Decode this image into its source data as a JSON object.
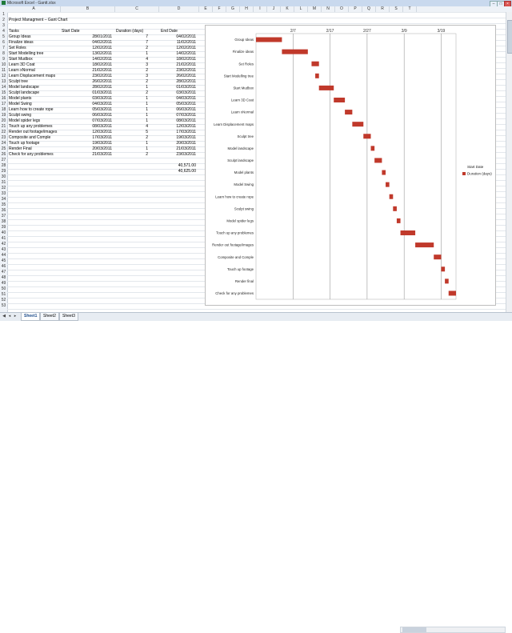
{
  "window": {
    "title": "Microsoft Excel - Gantt.xlsx"
  },
  "columns": [
    "A",
    "B",
    "C",
    "D",
    "E",
    "F",
    "G",
    "H",
    "I",
    "J",
    "K",
    "L",
    "M",
    "N",
    "O",
    "P",
    "Q",
    "R",
    "S",
    "T"
  ],
  "sheet": {
    "title": "Project Managment – Gant Chart",
    "headers": {
      "task": "Tasks",
      "start": "Start Date",
      "duration": "Duration (days)",
      "end": "End Date"
    },
    "rows": [
      {
        "task": "Group Ideas",
        "start": "28/01/2011",
        "duration": "7",
        "end": "04/02/2011"
      },
      {
        "task": "Finalize ideas",
        "start": "04/02/2011",
        "duration": "7",
        "end": "11/02/2011"
      },
      {
        "task": "Set Roles",
        "start": "12/02/2011",
        "duration": "2",
        "end": "12/02/2011"
      },
      {
        "task": "Start Modelling tree",
        "start": "13/02/2011",
        "duration": "1",
        "end": "14/02/2011"
      },
      {
        "task": "Start Mudbox",
        "start": "14/02/2011",
        "duration": "4",
        "end": "18/02/2011"
      },
      {
        "task": "Learn 3D Coat",
        "start": "18/02/2011",
        "duration": "3",
        "end": "21/02/2011"
      },
      {
        "task": "Learn xNormal",
        "start": "21/02/2011",
        "duration": "2",
        "end": "23/02/2011"
      },
      {
        "task": "Learn Displacement maps",
        "start": "23/02/2011",
        "duration": "3",
        "end": "26/02/2011"
      },
      {
        "task": "Sculpt tree",
        "start": "26/02/2011",
        "duration": "2",
        "end": "28/02/2011"
      },
      {
        "task": "Model landscape",
        "start": "28/02/2011",
        "duration": "1",
        "end": "01/03/2011"
      },
      {
        "task": "Sculpt landscape",
        "start": "01/03/2011",
        "duration": "2",
        "end": "03/03/2011"
      },
      {
        "task": "Model plants",
        "start": "03/03/2011",
        "duration": "1",
        "end": "04/03/2011"
      },
      {
        "task": "Model Swing",
        "start": "04/03/2011",
        "duration": "1",
        "end": "05/03/2011"
      },
      {
        "task": "Learn how to create rope",
        "start": "05/03/2011",
        "duration": "1",
        "end": "06/03/2011"
      },
      {
        "task": "Sculpt swing",
        "start": "06/03/2011",
        "duration": "1",
        "end": "07/03/2011"
      },
      {
        "task": "Model spider legs",
        "start": "07/03/2011",
        "duration": "1",
        "end": "08/03/2011"
      },
      {
        "task": "Touch up any problemes",
        "start": "08/03/2011",
        "duration": "4",
        "end": "12/03/2011"
      },
      {
        "task": "Render out footage/images",
        "start": "12/03/2011",
        "duration": "5",
        "end": "17/03/2011"
      },
      {
        "task": "Composite and Comple",
        "start": "17/03/2011",
        "duration": "2",
        "end": "19/03/2011"
      },
      {
        "task": "Touch up footage",
        "start": "19/03/2011",
        "duration": "1",
        "end": "20/03/2011"
      },
      {
        "task": "Render Final",
        "start": "20/03/2011",
        "duration": "1",
        "end": "21/03/2011"
      },
      {
        "task": "Check for any problemes",
        "start": "21/03/2011",
        "duration": "2",
        "end": "23/03/2011"
      }
    ],
    "extra_values": [
      "40,571.00",
      "40,625.00"
    ]
  },
  "chart_data": {
    "type": "bar",
    "orientation": "horizontal",
    "categories": [
      "Group Ideas",
      "Finalize ideas",
      "Set Roles",
      "Start Modelling tree",
      "Start Mudbox",
      "Learn 3D Coat",
      "Learn xNormal",
      "Learn Displacement maps",
      "Sculpt tree",
      "Model landscape",
      "Sculpt landscape",
      "Model plants",
      "Model Swing",
      "Learn how to create rope",
      "Sculpt swing",
      "Model spider legs",
      "Touch up any problemes",
      "Render out footage/images",
      "Composite and Comple",
      "Touch up footage",
      "Render final",
      "Check for any problemes"
    ],
    "series": [
      {
        "name": "Start Date",
        "color": "transparent",
        "values": [
          40571,
          40578,
          40586,
          40587,
          40588,
          40592,
          40595,
          40597,
          40600,
          40602,
          40603,
          40605,
          40606,
          40607,
          40608,
          40609,
          40610,
          40614,
          40619,
          40621,
          40622,
          40623
        ]
      },
      {
        "name": "Duration (days)",
        "color": "#c0392b",
        "values": [
          7,
          7,
          2,
          1,
          4,
          3,
          2,
          3,
          2,
          1,
          2,
          1,
          1,
          1,
          1,
          1,
          4,
          5,
          2,
          1,
          1,
          2
        ]
      }
    ],
    "x_ticks": [
      "2/7",
      "2/17",
      "2/27",
      "3/9",
      "3/19"
    ],
    "x_tick_values": [
      40581,
      40591,
      40601,
      40611,
      40621
    ],
    "xlim": [
      40571,
      40625
    ],
    "legend": "right",
    "grid": true
  },
  "tabs": [
    "Sheet1",
    "Sheet2",
    "Sheet3"
  ],
  "colors": {
    "bar": "#c0392b",
    "header_bg": "#eef2f7"
  }
}
